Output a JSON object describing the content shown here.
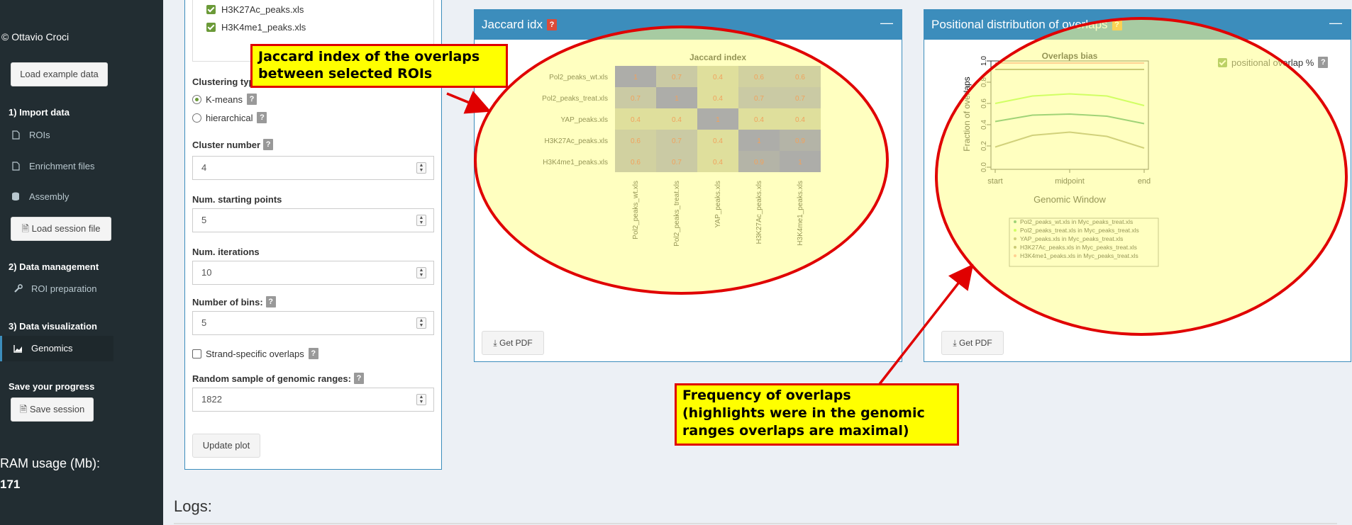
{
  "sidebar": {
    "copyright": "© Ottavio Croci",
    "load_example_label": "Load example data",
    "section_import": "1) Import data",
    "items_import": [
      {
        "label": "ROIs",
        "icon": "file-icon"
      },
      {
        "label": "Enrichment files",
        "icon": "file-icon"
      },
      {
        "label": "Assembly",
        "icon": "database-icon"
      }
    ],
    "load_session_label": "Load session file",
    "section_management": "2) Data management",
    "roi_prep_label": "ROI preparation",
    "section_visualization": "3) Data visualization",
    "genomics_label": "Genomics",
    "save_progress": "Save your progress",
    "save_session_label": "Save session",
    "ram_label": "RAM usage (Mb):",
    "ram_value": "171"
  },
  "settings": {
    "roi_list": [
      "H3K27Ac_peaks.xls",
      "H3K4me1_peaks.xls"
    ],
    "clustering_type_label": "Clustering type",
    "clustering_options": [
      {
        "label": "K-means",
        "selected": true
      },
      {
        "label": "hierarchical",
        "selected": false
      }
    ],
    "cluster_number_label": "Cluster number",
    "cluster_number_value": "4",
    "starting_points_label": "Num. starting points",
    "starting_points_value": "5",
    "iterations_label": "Num. iterations",
    "iterations_value": "10",
    "bins_label": "Number of bins:",
    "bins_value": "5",
    "strand_label": "Strand-specific overlaps",
    "random_sample_label": "Random sample of genomic ranges:",
    "random_sample_value": "1822",
    "update_label": "Update plot"
  },
  "jaccard_box": {
    "title": "Jaccard idx",
    "help": "?",
    "pdf_label": "Get PDF"
  },
  "positional_box": {
    "title": "Positional distribution of overlaps",
    "help": "?",
    "checkbox_label": "positional overlap %",
    "pdf_label": "Get PDF"
  },
  "callouts": {
    "jaccard": "Jaccard index of the overlaps\nbetween selected ROIs",
    "frequency": "Frequency of overlaps\n(highlights were in the genomic\nranges overlaps are maximal)"
  },
  "logs_label": "Logs:",
  "colors": {
    "sidebar_bg": "#222d32",
    "box_header": "#3c8dbc",
    "highlight": "#e00000"
  },
  "chart_data": [
    {
      "type": "heatmap",
      "title": "Jaccard index",
      "rows": [
        "Pol2_peaks_wt.xls",
        "Pol2_peaks_treat.xls",
        "YAP_peaks.xls",
        "H3K27Ac_peaks.xls",
        "H3K4me1_peaks.xls"
      ],
      "columns": [
        "Pol2_peaks_wt.xls",
        "Pol2_peaks_treat.xls",
        "YAP_peaks.xls",
        "H3K27Ac_peaks.xls",
        "H3K4me1_peaks.xls"
      ],
      "values": [
        [
          1,
          0.7,
          0.4,
          0.6,
          0.6
        ],
        [
          0.7,
          1,
          0.4,
          0.7,
          0.7
        ],
        [
          0.4,
          0.4,
          1,
          0.4,
          0.4
        ],
        [
          0.6,
          0.7,
          0.4,
          1,
          0.9
        ],
        [
          0.6,
          0.7,
          0.4,
          0.9,
          1
        ]
      ]
    },
    {
      "type": "line",
      "title": "Overlaps bias",
      "xlabel": "Genomic Window",
      "ylabel": "Fraction of overlaps",
      "x_ticks": [
        "start",
        "midpoint",
        "end"
      ],
      "ylim": [
        0,
        1
      ],
      "y_ticks": [
        "0.0",
        "0.2",
        "0.4",
        "0.6",
        "0.8",
        "1.0"
      ],
      "x": [
        1,
        2,
        3,
        4,
        5
      ],
      "series": [
        {
          "name": "Pol2_peaks_wt.xls in Myc_peaks_treat.xls",
          "color": "#2e9e5e",
          "values": [
            0.43,
            0.49,
            0.5,
            0.48,
            0.41
          ]
        },
        {
          "name": "Pol2_peaks_treat.xls in Myc_peaks_treat.xls",
          "color": "#99ff33",
          "values": [
            0.6,
            0.67,
            0.69,
            0.67,
            0.58
          ]
        },
        {
          "name": "YAP_peaks.xls in Myc_peaks_treat.xls",
          "color": "#999966",
          "values": [
            0.19,
            0.3,
            0.33,
            0.29,
            0.18
          ]
        },
        {
          "name": "H3K27Ac_peaks.xls in Myc_peaks_treat.xls",
          "color": "#8a8a5a",
          "values": [
            0.92,
            0.92,
            0.92,
            0.92,
            0.92
          ]
        },
        {
          "name": "H3K4me1_peaks.xls in Myc_peaks_treat.xls",
          "color": "#ff9999",
          "values": [
            0.98,
            0.98,
            0.98,
            0.98,
            0.98
          ]
        }
      ]
    }
  ]
}
